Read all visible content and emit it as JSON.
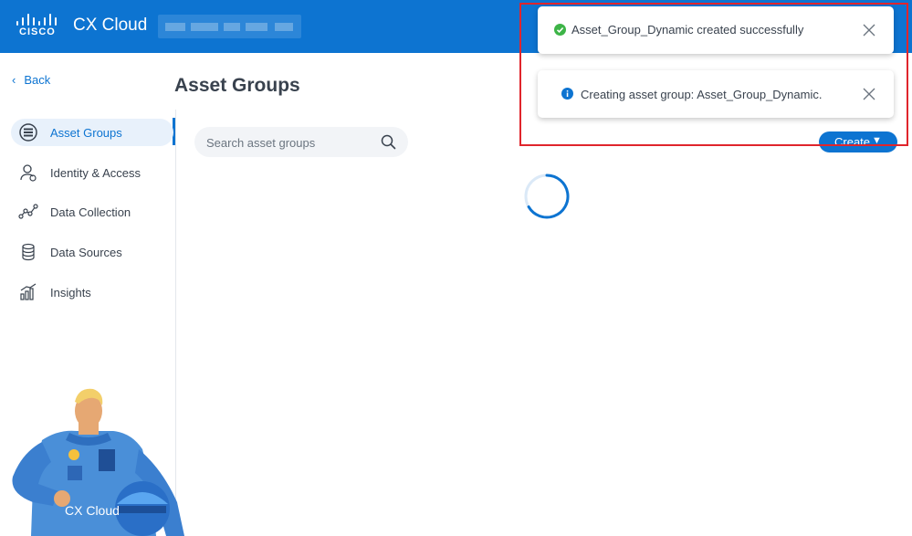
{
  "header": {
    "logo_word": "CISCO",
    "app_title": "CX Cloud"
  },
  "sidebar": {
    "back_label": "Back",
    "items": [
      {
        "label": "Asset Groups",
        "icon": "asset-groups-icon",
        "active": true
      },
      {
        "label": "Identity & Access",
        "icon": "identity-icon",
        "active": false
      },
      {
        "label": "Data Collection",
        "icon": "data-collection-icon",
        "active": false
      },
      {
        "label": "Data Sources",
        "icon": "database-icon",
        "active": false
      },
      {
        "label": "Insights",
        "icon": "insights-icon",
        "active": false
      }
    ]
  },
  "main": {
    "page_title": "Asset Groups",
    "search": {
      "placeholder": "Search asset groups",
      "value": ""
    },
    "create_label": "Create",
    "loading": true
  },
  "toasts": [
    {
      "type": "success",
      "message": "Asset_Group_Dynamic created successfully"
    },
    {
      "type": "info",
      "message": "Creating asset group: Asset_Group_Dynamic."
    }
  ],
  "mascot": {
    "caption": "CX Cloud"
  },
  "colors": {
    "brand_blue": "#0d74d1",
    "success_green": "#3db447",
    "info_blue": "#0d74d1",
    "highlight_red": "#e0252c"
  }
}
